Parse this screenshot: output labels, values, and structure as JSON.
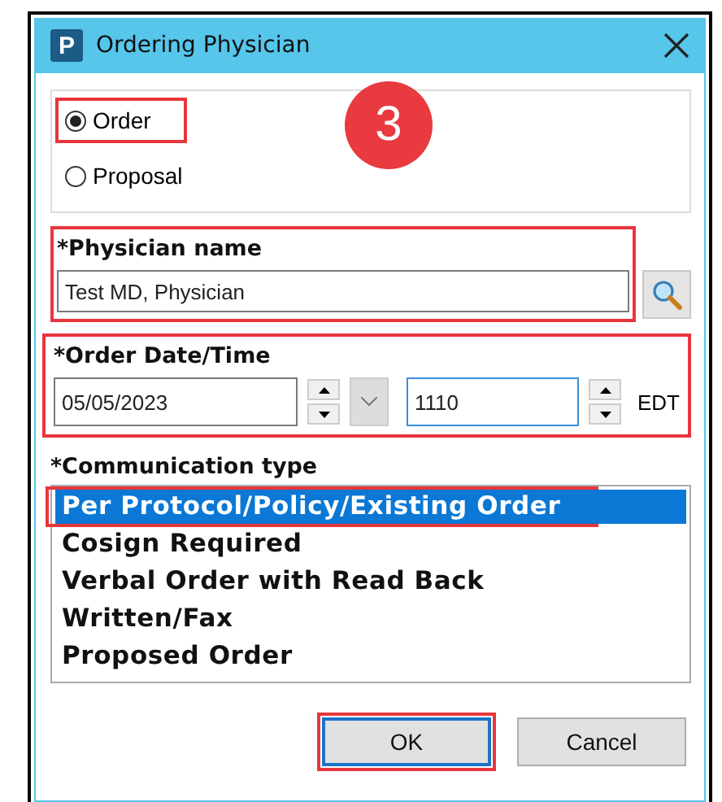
{
  "window": {
    "title": "Ordering Physician",
    "app_icon": "P"
  },
  "step_badge": "3",
  "mode": {
    "options": [
      {
        "label": "Order",
        "selected": true,
        "highlighted": true
      },
      {
        "label": "Proposal",
        "selected": false,
        "highlighted": false
      }
    ]
  },
  "physician": {
    "label": "*Physician name",
    "value": "Test MD, Physician",
    "highlighted": true
  },
  "order_datetime": {
    "label": "*Order Date/Time",
    "date": "05/05/2023",
    "time": "1110",
    "timezone": "EDT",
    "highlighted": true
  },
  "communication": {
    "label": "*Communication type",
    "items": [
      {
        "label": "Per Protocol/Policy/Existing Order",
        "selected": true,
        "highlighted": true
      },
      {
        "label": "Cosign Required",
        "selected": false,
        "highlighted": false
      },
      {
        "label": "Verbal Order with Read Back",
        "selected": false,
        "highlighted": false
      },
      {
        "label": "Written/Fax",
        "selected": false,
        "highlighted": false
      },
      {
        "label": "Proposed Order",
        "selected": false,
        "highlighted": false
      }
    ]
  },
  "buttons": [
    {
      "label": "OK",
      "default": true,
      "highlighted": true
    },
    {
      "label": "Cancel",
      "default": false,
      "highlighted": false
    }
  ]
}
